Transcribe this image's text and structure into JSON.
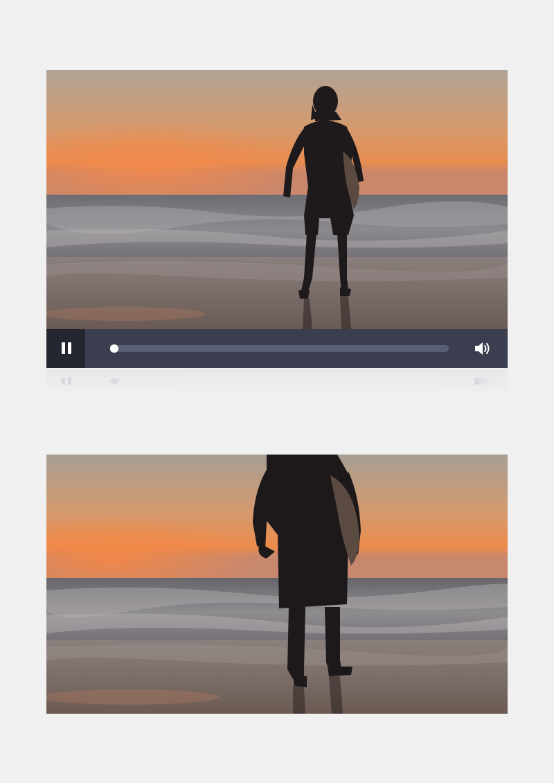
{
  "player": {
    "state": "playing",
    "progress": 0.01,
    "icons": {
      "pause": "pause-icon",
      "volume": "volume-icon"
    },
    "colors": {
      "control_bar": "#3b3e4f",
      "play_button_bg": "#242630",
      "track": "#5b5f74",
      "knob": "#ffffff"
    }
  },
  "frames": [
    {
      "scene": "surfer-silhouette-sunset-beach-wide"
    },
    {
      "scene": "surfer-silhouette-sunset-beach-closeup"
    }
  ]
}
